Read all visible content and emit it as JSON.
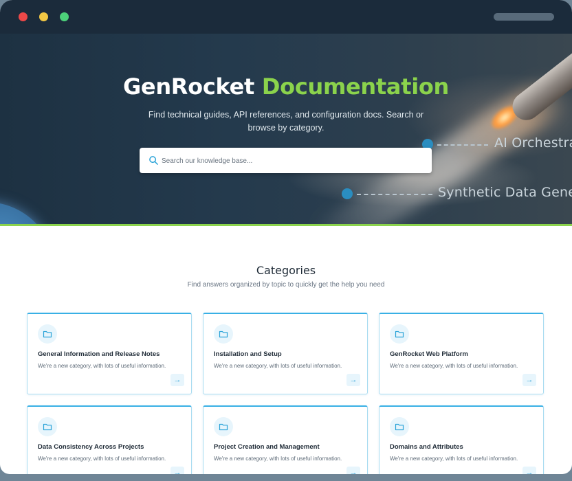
{
  "window": {
    "controls": [
      "close",
      "minimize",
      "maximize"
    ]
  },
  "hero": {
    "title_main": "GenRocket",
    "title_accent": "Documentation",
    "subtitle": "Find technical guides, API references, and configuration docs. Search or browse by category.",
    "search_placeholder": "Search our knowledge base...",
    "labels": [
      "AI Orchestrat",
      "Synthetic Data Genera"
    ]
  },
  "categories": {
    "title": "Categories",
    "subtitle": "Find answers organized by topic to quickly get the help you need",
    "items": [
      {
        "title": "General Information and Release Notes",
        "description": "We're a new category, with lots of useful information.",
        "icon": "folder-icon"
      },
      {
        "title": "Installation and Setup",
        "description": "We're a new category, with lots of useful information.",
        "icon": "folder-icon"
      },
      {
        "title": "GenRocket Web Platform",
        "description": "We're a new category, with lots of useful information.",
        "icon": "folder-icon"
      },
      {
        "title": "Data Consistency Across Projects",
        "description": "We're a new category, with lots of useful information.",
        "icon": "folder-icon"
      },
      {
        "title": "Project Creation and Management",
        "description": "We're a new category, with lots of useful information.",
        "icon": "folder-icon"
      },
      {
        "title": "Domains and Attributes",
        "description": "We're a new category, with lots of useful information.",
        "icon": "folder-icon"
      }
    ],
    "arrow_glyph": "→"
  },
  "colors": {
    "accent_green": "#8bd34c",
    "accent_blue": "#39b0e5",
    "hero_bg": "#1d3142"
  }
}
